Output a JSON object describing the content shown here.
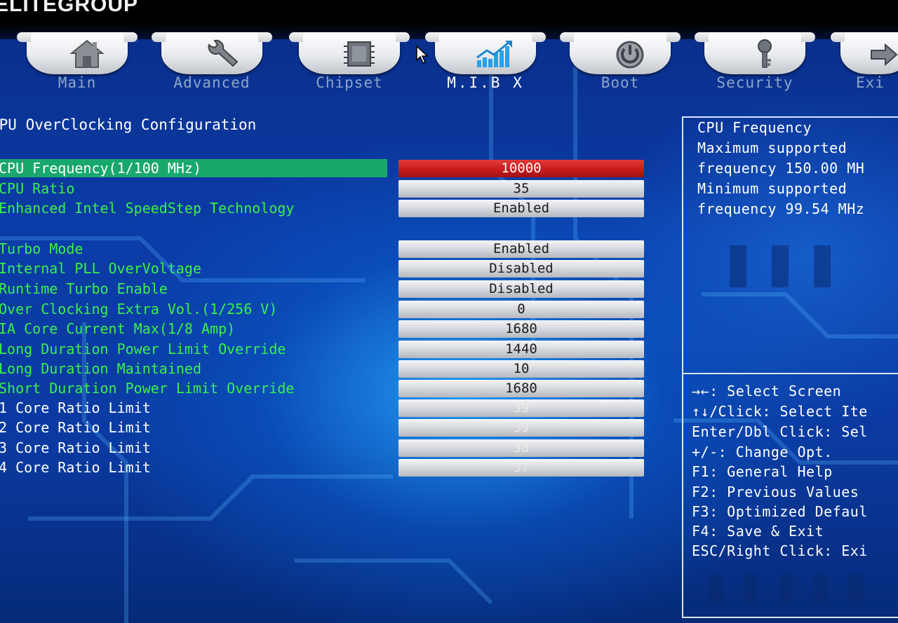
{
  "brand": {
    "logo_text": "ELITEGROUP"
  },
  "tabs": [
    {
      "label": "Main",
      "icon": "house-icon",
      "active": false
    },
    {
      "label": "Advanced",
      "icon": "wrench-icon",
      "active": false
    },
    {
      "label": "Chipset",
      "icon": "chip-icon",
      "active": false
    },
    {
      "label": "M.I.B X",
      "icon": "chart-icon",
      "active": true
    },
    {
      "label": "Boot",
      "icon": "power-icon",
      "active": false
    },
    {
      "label": "Security",
      "icon": "key-icon",
      "active": false
    },
    {
      "label": "Exi",
      "icon": "exit-icon",
      "active": false
    }
  ],
  "section_title": "CPU OverClocking Configuration",
  "settings": [
    {
      "label": "CPU Frequency(1/100 MHz)",
      "value": "10000"
    },
    {
      "label": "CPU Ratio",
      "value": "35"
    },
    {
      "label": "Enhanced Intel SpeedStep Technology",
      "value": "Enabled"
    },
    {
      "label": "Turbo Mode",
      "value": "Enabled"
    },
    {
      "label": "Internal PLL OverVoltage",
      "value": "Disabled"
    },
    {
      "label": "Runtime Turbo Enable",
      "value": "Disabled"
    },
    {
      "label": "Over Clocking Extra Vol.(1/256 V)",
      "value": "0"
    },
    {
      "label": "IA Core Current Max(1/8 Amp)",
      "value": "1680"
    },
    {
      "label": "Long Duration Power Limit Override",
      "value": "1440"
    },
    {
      "label": "Long Duration Maintained",
      "value": "10"
    },
    {
      "label": "Short Duration Power Limit Override",
      "value": "1680"
    },
    {
      "label": "1 Core Ratio Limit",
      "value": "39"
    },
    {
      "label": "2 Core Ratio Limit",
      "value": "39"
    },
    {
      "label": "3 Core Ratio Limit",
      "value": "38"
    },
    {
      "label": "4 Core Ratio Limit",
      "value": "37"
    }
  ],
  "help": {
    "lines": [
      "CPU Frequency",
      "Maximum supported",
      "frequency 150.00 MH",
      "Minimum supported",
      "frequency 99.54 MHz"
    ]
  },
  "keys": [
    "→←: Select Screen",
    "↑↓/Click: Select Ite",
    "Enter/Dbl Click: Sel",
    "+/-: Change Opt.",
    "F1: General Help",
    "F2: Previous Values",
    "F3: Optimized Defaul",
    "F4: Save & Exit",
    "ESC/Right Click: Exi"
  ],
  "colors": {
    "label_green": "#39f048",
    "selected_row": "#19a86c",
    "selected_value": "#c91c1c",
    "background_blue": "#0b3ca8"
  }
}
